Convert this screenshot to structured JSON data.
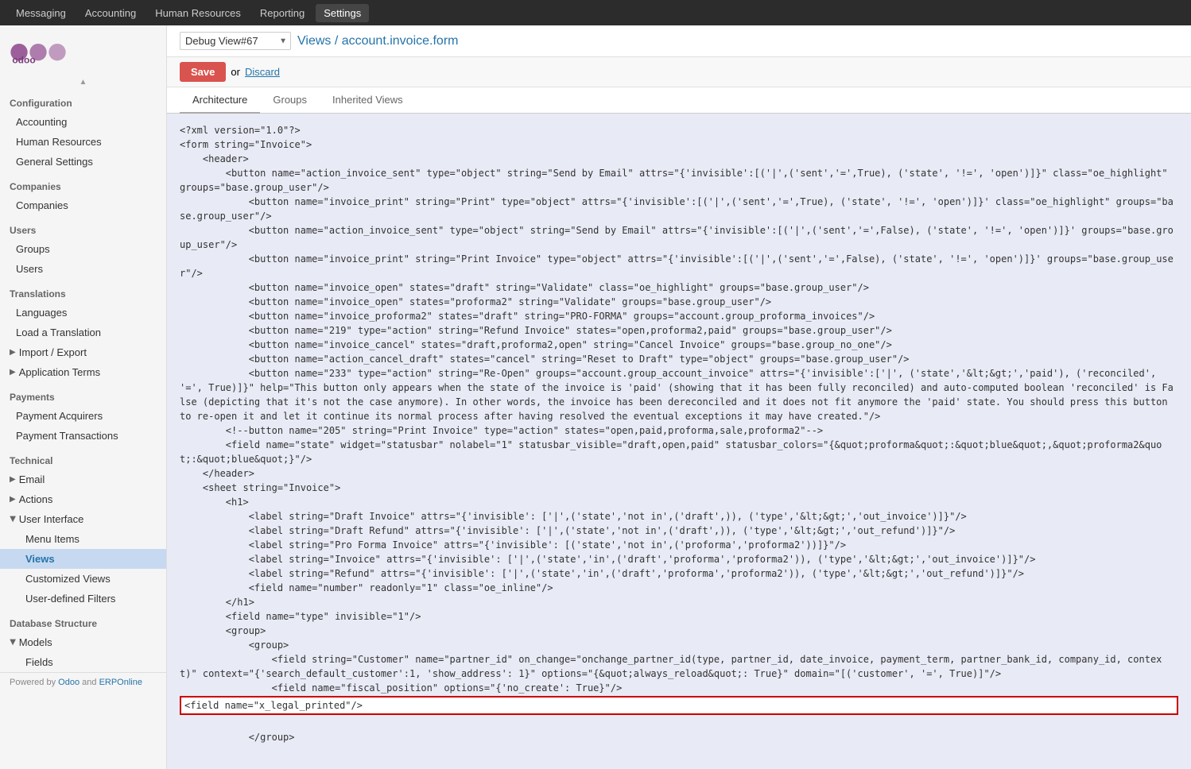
{
  "topNav": {
    "items": [
      {
        "label": "Messaging",
        "active": false
      },
      {
        "label": "Accounting",
        "active": false
      },
      {
        "label": "Human Resources",
        "active": false
      },
      {
        "label": "Reporting",
        "active": false
      },
      {
        "label": "Settings",
        "active": true
      }
    ]
  },
  "debugSelect": {
    "value": "Debug View#67",
    "arrow": "▼"
  },
  "breadcrumb": {
    "prefix": "Views /",
    "title": "account.invoice.form"
  },
  "actionBar": {
    "saveLabel": "Save",
    "orLabel": "or",
    "discardLabel": "Discard"
  },
  "tabs": [
    {
      "label": "Architecture",
      "active": true
    },
    {
      "label": "Groups",
      "active": false
    },
    {
      "label": "Inherited Views",
      "active": false
    }
  ],
  "sidebar": {
    "sections": [
      {
        "title": "Configuration",
        "items": [
          {
            "label": "Accounting",
            "type": "item",
            "active": false
          },
          {
            "label": "Human Resources",
            "type": "item",
            "active": false
          },
          {
            "label": "General Settings",
            "type": "item",
            "active": false
          }
        ]
      },
      {
        "title": "Companies",
        "items": [
          {
            "label": "Companies",
            "type": "item",
            "active": false
          }
        ]
      },
      {
        "title": "Users",
        "items": [
          {
            "label": "Groups",
            "type": "item",
            "active": false
          },
          {
            "label": "Users",
            "type": "item",
            "active": false
          }
        ]
      },
      {
        "title": "Translations",
        "items": [
          {
            "label": "Languages",
            "type": "item",
            "active": false
          },
          {
            "label": "Load a Translation",
            "type": "item",
            "active": false
          },
          {
            "label": "Import / Export",
            "type": "item-arrow",
            "active": false
          },
          {
            "label": "Application Terms",
            "type": "item-arrow",
            "active": false
          }
        ]
      },
      {
        "title": "Payments",
        "items": [
          {
            "label": "Payment Acquirers",
            "type": "item",
            "active": false
          },
          {
            "label": "Payment Transactions",
            "type": "item",
            "active": false
          }
        ]
      },
      {
        "title": "Technical",
        "items": [
          {
            "label": "Email",
            "type": "item-arrow",
            "active": false
          },
          {
            "label": "Actions",
            "type": "item-arrow",
            "active": false
          },
          {
            "label": "User Interface",
            "type": "item-arrow-expanded",
            "active": false
          },
          {
            "label": "Menu Items",
            "type": "subitem",
            "active": false
          },
          {
            "label": "Views",
            "type": "subitem",
            "active": true
          },
          {
            "label": "Customized Views",
            "type": "subitem",
            "active": false
          },
          {
            "label": "User-defined Filters",
            "type": "subitem",
            "active": false
          }
        ]
      },
      {
        "title": "Database Structure",
        "items": [
          {
            "label": "Models",
            "type": "item-arrow-expanded",
            "active": false
          },
          {
            "label": "Fields",
            "type": "subitem",
            "active": false
          }
        ]
      }
    ]
  },
  "poweredBy": {
    "text": "Powered by",
    "link1": "Odoo",
    "and": "and",
    "link2": "ERPOnline"
  },
  "codeContent": "<?xml version=\"1.0\"?>\n<form string=\"Invoice\">\n    <header>\n        <button name=\"action_invoice_sent\" type=\"object\" string=\"Send by Email\" attrs=\"{'invisible':[('|',('sent','=',True), ('state', '!=', 'open')])}\" class=\"oe_highlight\" groups=\"base.group_user\"/>\n            <button name=\"invoice_print\" string=\"Print\" type=\"object\" attrs=\"{'invisible':[('|',('sent','=',True), ('state', '!=', 'open')]}\" class=\"oe_highlight\" groups=\"base.group_user\"/>\n            <button name=\"action_invoice_sent\" type=\"object\" string=\"Send by Email\" attrs=\"{'invisible':[('|',('sent','=',False), ('state', '!=', 'open')]}\" groups=\"base.group_user\"/>\n            <button name=\"invoice_print\" string=\"Print Invoice\" type=\"object\" attrs=\"{'invisible':[('|',('sent','=',False), ('state', '!=', 'open')]}\" groups=\"base.group_user\"/>\n            <button name=\"invoice_open\" states=\"draft\" string=\"Validate\" class=\"oe_highlight\" groups=\"base.group_user\"/>\n            <button name=\"invoice_open\" states=\"proforma2\" string=\"Validate\" groups=\"base.group_user\"/>\n            <button name=\"invoice_proforma2\" states=\"draft\" string=\"PRO-FORMA\" groups=\"account.group_proforma_invoices\"/>\n            <button name=\"219\" type=\"action\" string=\"Refund Invoice\" states=\"open,proforma2,paid\" groups=\"base.group_user\"/>\n            <button name=\"invoice_cancel\" states=\"draft,proforma2,open\" string=\"Cancel Invoice\" groups=\"base.group_no_one\"/>\n            <button name=\"action_cancel_draft\" states=\"cancel\" string=\"Reset to Draft\" type=\"object\" groups=\"base.group_user\"/>\n            <button name=\"233\" type=\"action\" string=\"Re-Open\" groups=\"account.group_account_invoice\" attrs=\"{'invisible':['|', ('state','&lt;&gt;','paid'), ('reconciled', '=', True)]}\" help=\"This button only appears when the state of the invoice is 'paid' (showing that it has been fully reconciled) and auto-computed boolean 'reconciled' is False (depicting that it's not the case anymore). In other words, the invoice has been dereconciled and it does not fit anymore the 'paid' state. You should press this button to re-open it and let it continue its normal process after having resolved the eventual exceptions it may have created.\"/>\n        <!--button name=\"205\" string=\"Print Invoice\" type=\"action\" states=\"open,paid,proforma,sale,proforma2\"-->\n        <field name=\"state\" widget=\"statusbar\" nolabel=\"1\" statusbar_visible=\"draft,open,paid\" statusbar_colors=\"{&quot;proforma&quot;:&quot;blue&quot;,&quot;proforma2&quot;:&quot;blue&quot;}\"/>\n    </header>\n    <sheet string=\"Invoice\">\n        <h1>\n            <label string=\"Draft Invoice\" attrs=\"{'invisible': ['|',('state','not in',('draft',)), ('type','&lt;&gt;','out_invoice')]}\"/>\n            <label string=\"Draft Refund\" attrs=\"{'invisible': ['|',('state','not in',('draft',)), ('type','&lt;&gt;','out_refund')]}\"/>\n            <label string=\"Pro Forma Invoice\" attrs=\"{'invisible': [('state','not in',('proforma','proforma2'))]}\"/>\n            <label string=\"Invoice\" attrs=\"{'invisible': ['|',('state','in',('draft','proforma','proforma2')), ('type','&lt;&gt;','out_invoice')]}\"/>\n            <label string=\"Refund\" attrs=\"{'invisible': ['|',('state','in',('draft','proforma','proforma2')), ('type','&lt;&gt;','out_refund')]}\"/>\n            <field name=\"number\" readonly=\"1\" class=\"oe_inline\"/>\n        </h1>\n        <field name=\"type\" invisible=\"1\"/>\n        <group>\n            <group>\n                <field string=\"Customer\" name=\"partner_id\" on_change=\"onchange_partner_id(type, partner_id, date_invoice, payment_term, partner_bank_id, company_id, context)\" context=\"{'search_default_customer':1, 'show_address': 1}\" options=\"{&quot;always_reload&quot;: True}\" domain=\"[('customer', '=', True)]\"/>\n                <field name=\"fiscal_position\" options=\"{'no_create': True}\"/>"
}
